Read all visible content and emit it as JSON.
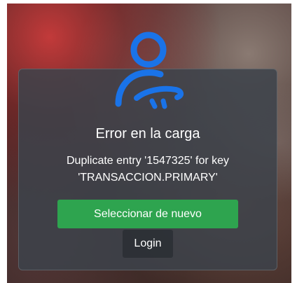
{
  "dialog": {
    "title": "Error en la carga",
    "message": "Duplicate entry '1547325' for key 'TRANSACCION.PRIMARY'",
    "primary_button": "Seleccionar de nuevo",
    "secondary_button": "Login"
  },
  "icon": {
    "name": "user-key-icon",
    "color": "#1a73e8"
  },
  "colors": {
    "primary_button": "#2ea44f",
    "card_background": "#3c424a"
  }
}
